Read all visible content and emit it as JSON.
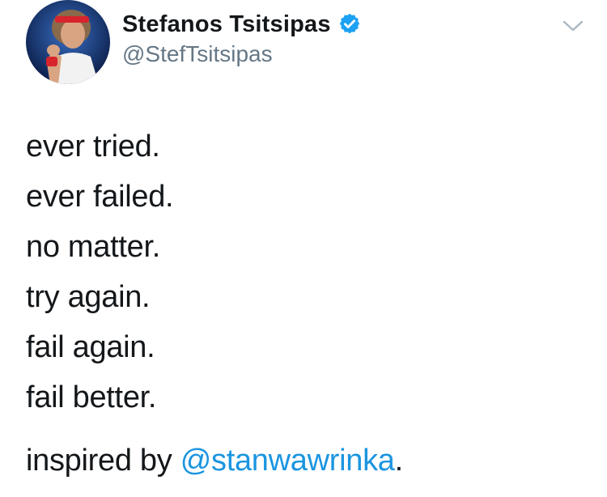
{
  "user": {
    "display_name": "Stefanos Tsitsipas",
    "handle": "@StefTsitsipas",
    "verified": true
  },
  "icons": {
    "verified": "verified-badge-icon",
    "menu": "chevron-down-icon"
  },
  "tweet": {
    "lines": [
      "ever tried.",
      "ever failed.",
      "no matter.",
      "try again.",
      "fail again.",
      "fail better."
    ],
    "credit_prefix": "inspired by ",
    "credit_mention": "@stanwawrinka",
    "credit_suffix": "."
  },
  "colors": {
    "text": "#14171a",
    "secondary": "#657786",
    "link": "#1b95e0",
    "verified": "#1da1f2"
  }
}
